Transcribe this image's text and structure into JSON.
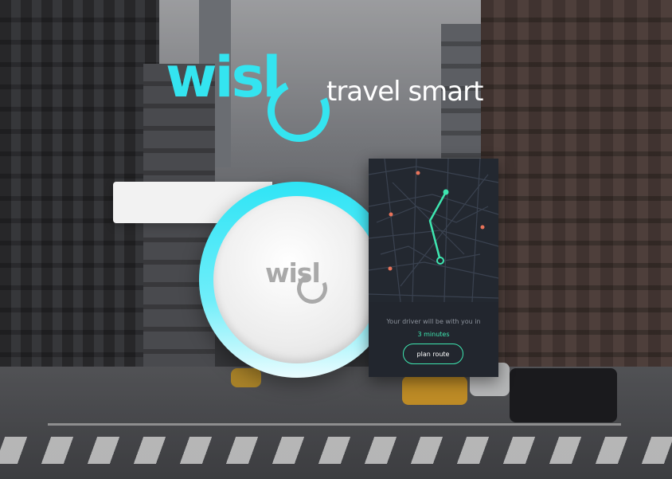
{
  "brand": {
    "logo_text": "wisl",
    "tagline": "travel smart",
    "accent_color": "#34e4f0"
  },
  "device": {
    "logo_text": "wisl"
  },
  "phone": {
    "message": "Your driver will be with you in",
    "eta": "3 minutes",
    "button_label": "plan route",
    "route_color": "#3ee6b0",
    "poi_color": "#e8735a"
  },
  "background": {
    "scene": "city-street-icon"
  }
}
